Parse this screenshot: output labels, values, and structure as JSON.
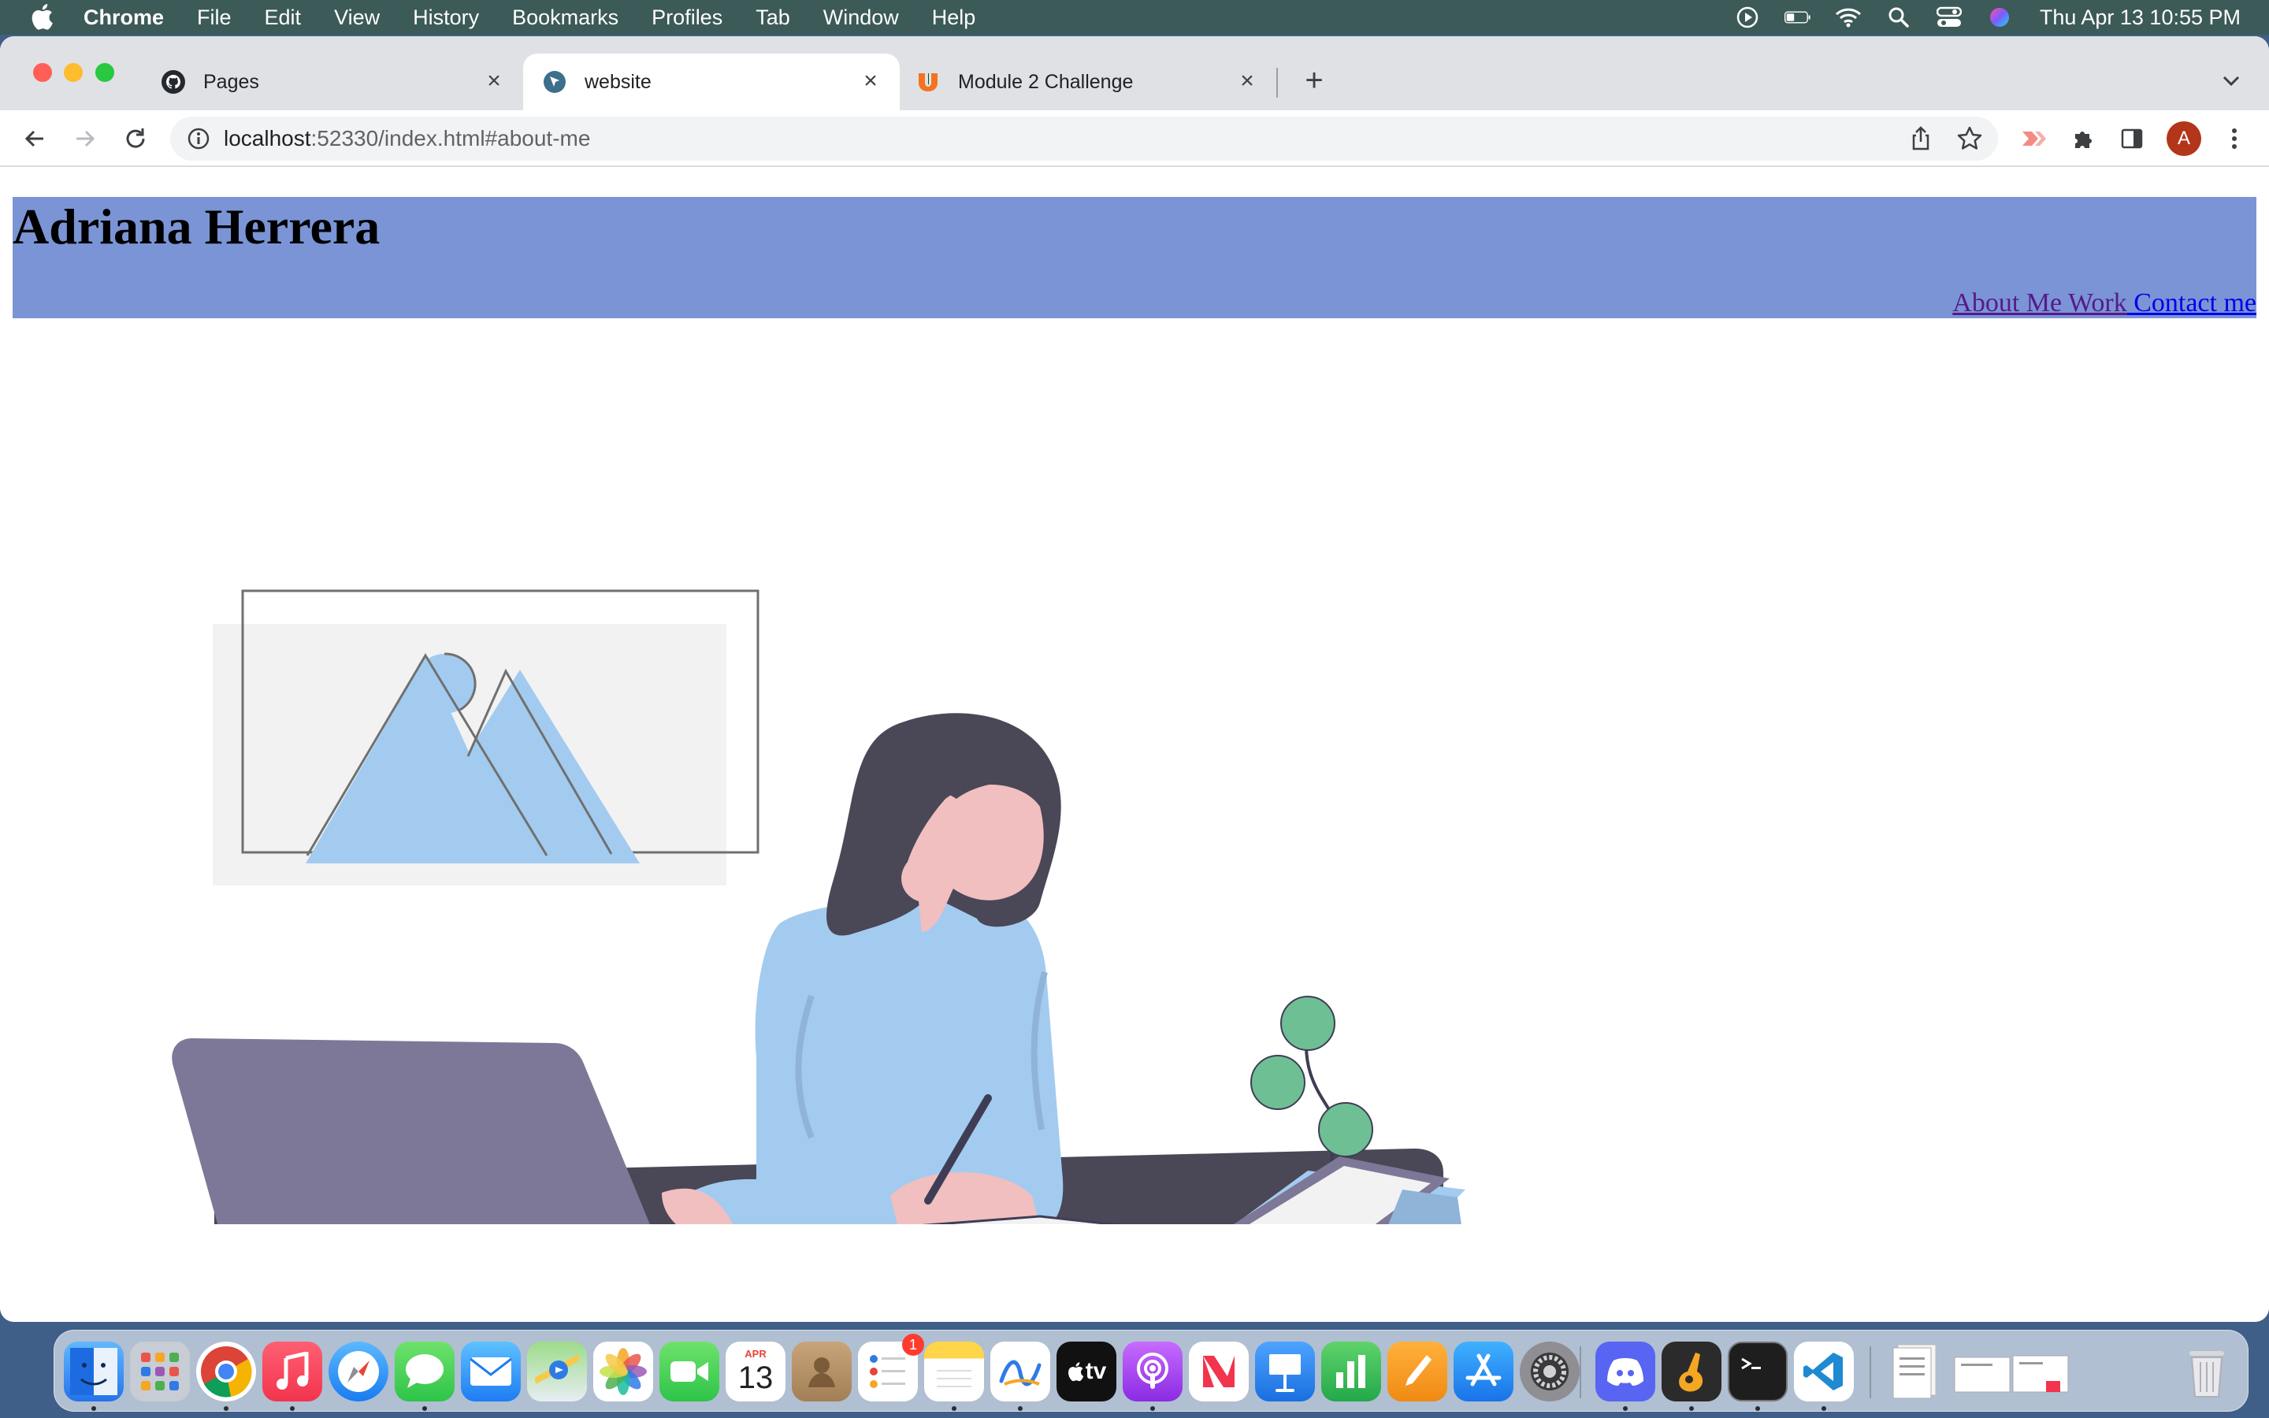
{
  "menubar": {
    "app_name": "Chrome",
    "menus": [
      "File",
      "Edit",
      "View",
      "History",
      "Bookmarks",
      "Profiles",
      "Tab",
      "Window",
      "Help"
    ],
    "clock": "Thu Apr 13  10:55 PM",
    "status_icons": [
      "play-circle-icon",
      "battery-icon",
      "wifi-icon",
      "spotlight-search-icon",
      "control-center-icon",
      "siri-icon"
    ]
  },
  "tabs": [
    {
      "title": "Pages",
      "icon": "github-icon"
    },
    {
      "title": "website",
      "icon": "website-favicon-icon"
    },
    {
      "title": "Module 2 Challenge",
      "icon": "module-favicon-icon"
    }
  ],
  "toolbar": {
    "url_host": "localhost",
    "url_rest": ":52330/index.html#about-me",
    "avatar_letter": "A"
  },
  "page": {
    "title": "Adriana Herrera",
    "nav": [
      "About Me",
      "Work",
      "Contact me"
    ],
    "hero_image": "woman-at-desk-illustration"
  },
  "dock": {
    "apps": [
      "Finder",
      "Launchpad",
      "Chrome",
      "Music",
      "Safari",
      "Messages",
      "Mail",
      "Maps",
      "Photos",
      "FaceTime",
      "Calendar",
      "Contacts",
      "Reminders",
      "Notes",
      "Freeform",
      "TV",
      "Podcasts",
      "News",
      "Keynote",
      "Numbers",
      "Pages",
      "App Store",
      "System Settings",
      "Discord",
      "GarageBand",
      "Terminal",
      "VS Code",
      "Downloads",
      "Documents",
      "Trash"
    ],
    "calendar_month": "APR",
    "calendar_day": "13",
    "reminders_badge": "1",
    "tv_label": "tv"
  },
  "colors": {
    "header_bg": "#7b94d5",
    "menubar_bg": "#3c5a57",
    "visited_link": "#551a8b",
    "link": "#0000ee"
  }
}
